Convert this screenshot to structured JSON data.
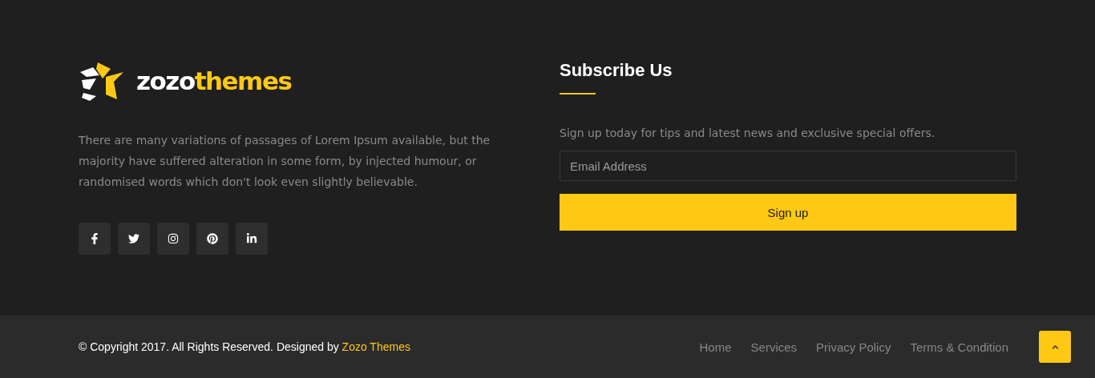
{
  "brand": {
    "logo_light": "zozo",
    "logo_accent": "themes"
  },
  "about": {
    "text": "There are many variations of passages of Lorem Ipsum available, but the majority have suffered alteration in some form, by injected humour, or randomised words which don't look even slightly believable."
  },
  "social": [
    {
      "kind": "facebook"
    },
    {
      "kind": "twitter"
    },
    {
      "kind": "instagram"
    },
    {
      "kind": "pinterest"
    },
    {
      "kind": "linkedin"
    }
  ],
  "subscribe": {
    "title": "Subscribe Us",
    "text": "Sign up today for tips and latest news and exclusive special offers.",
    "placeholder": "Email Address",
    "button": "Sign up"
  },
  "bottom_bar": {
    "copyright": "© Copyright 2017. All Rights Reserved. Designed by",
    "designer_link": "Zozo Themes",
    "links": [
      "Home",
      "Services",
      "Privacy Policy",
      "Terms & Condition"
    ]
  }
}
